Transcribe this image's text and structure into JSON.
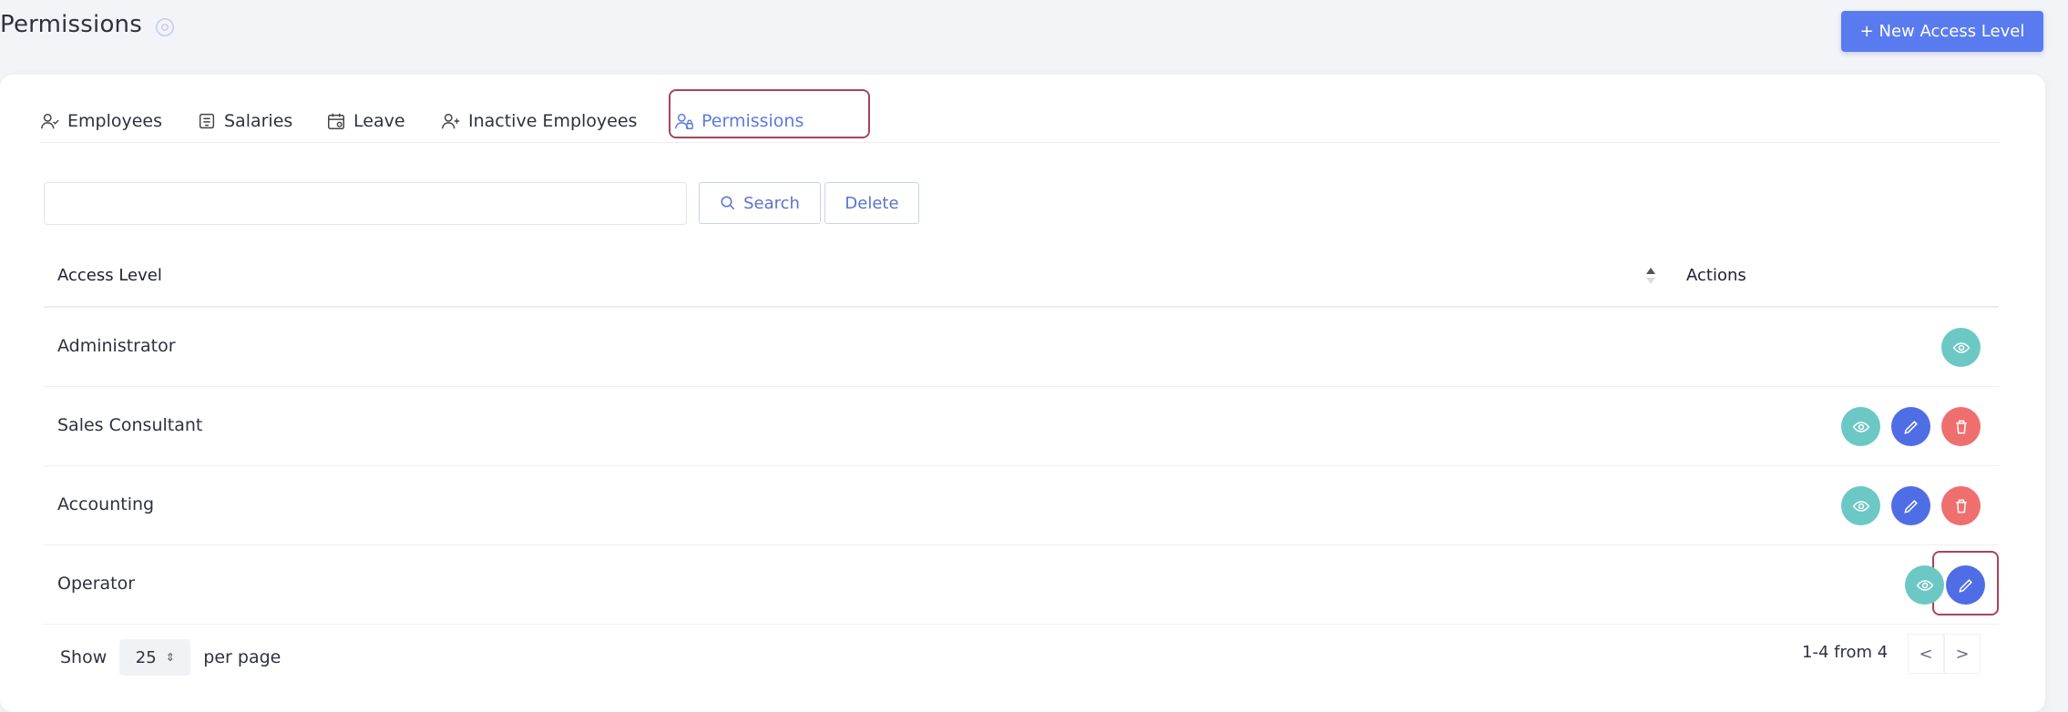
{
  "header": {
    "title": "Permissions",
    "settings_icon": "gear-circle-icon",
    "new_button_label": "+ New Access Level"
  },
  "tabs": [
    {
      "label": "Employees",
      "icon": "user-check-icon",
      "active": false
    },
    {
      "label": "Salaries",
      "icon": "wallet-icon",
      "active": false
    },
    {
      "label": "Leave",
      "icon": "calendar-icon",
      "active": false
    },
    {
      "label": "Inactive Employees",
      "icon": "user-plus-icon",
      "active": false
    },
    {
      "label": "Permissions",
      "icon": "user-lock-icon",
      "active": true
    }
  ],
  "search": {
    "value": "",
    "placeholder": "",
    "search_label": "Search",
    "delete_label": "Delete"
  },
  "table": {
    "columns": [
      "Access Level",
      "Actions"
    ],
    "rows": [
      {
        "name": "Administrator",
        "actions": [
          "view"
        ]
      },
      {
        "name": "Sales Consultant",
        "actions": [
          "view",
          "edit",
          "delete"
        ]
      },
      {
        "name": "Accounting",
        "actions": [
          "view",
          "edit",
          "delete"
        ]
      },
      {
        "name": "Operator",
        "actions": [
          "view",
          "edit"
        ]
      }
    ]
  },
  "footer": {
    "show_label": "Show",
    "per_page_value": "25",
    "per_page_label": "per page",
    "range": "1-4 from 4",
    "prev": "<",
    "next": ">"
  },
  "colors": {
    "primary": "#5a7bf0",
    "view": "#6cc8c5",
    "edit": "#4f6ee6",
    "delete": "#ef6f6f",
    "highlight": "#a9445a"
  }
}
